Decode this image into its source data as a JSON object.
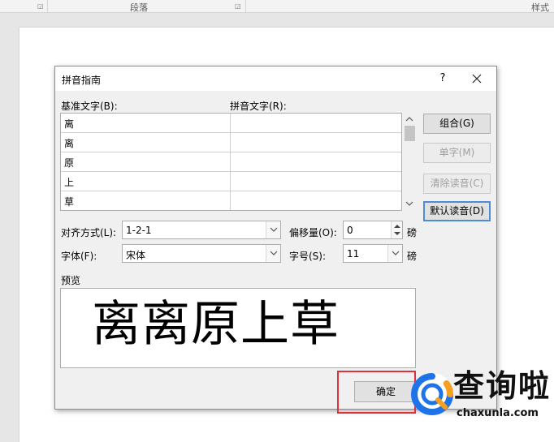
{
  "ribbon": {
    "paragraph_label": "段落",
    "styles_label": "样式"
  },
  "dialog": {
    "title": "拼音指南",
    "help_label": "?",
    "base_text_label": "基准文字(B):",
    "ruby_text_label": "拼音文字(R):",
    "rows": [
      {
        "base": "离",
        "ruby": ""
      },
      {
        "base": "离",
        "ruby": ""
      },
      {
        "base": "原",
        "ruby": ""
      },
      {
        "base": "上",
        "ruby": ""
      },
      {
        "base": "草",
        "ruby": ""
      }
    ],
    "buttons": {
      "group": "组合(G)",
      "mono": "单字(M)",
      "clear": "清除读音(C)",
      "default": "默认读音(D)",
      "ok": "确定"
    },
    "alignment": {
      "label": "对齐方式(L):",
      "value": "1-2-1"
    },
    "offset": {
      "label": "偏移量(O):",
      "value": "0",
      "unit": "磅"
    },
    "font": {
      "label": "字体(F):",
      "value": "宋体"
    },
    "size": {
      "label": "字号(S):",
      "value": "11",
      "unit": "磅"
    },
    "preview": {
      "label": "预览",
      "text": "离离原上草"
    }
  },
  "watermark": {
    "brand_cn": "查询啦",
    "brand_en": "chaxunla.com"
  },
  "colors": {
    "highlight": "#e0303a",
    "watermark_blue": "#1e73e8",
    "watermark_orange": "#f5a020",
    "focus_blue": "#4f8ad6"
  }
}
